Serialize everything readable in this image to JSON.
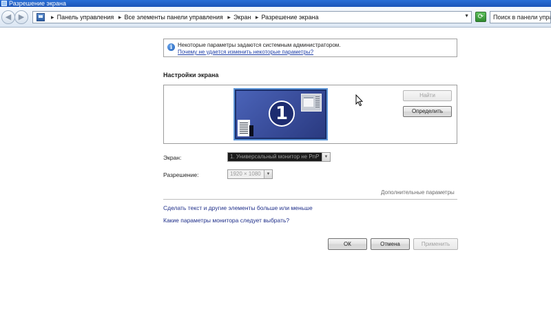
{
  "window": {
    "title": "Разрешение экрана"
  },
  "address_bar": {
    "crumbs": [
      "Панель управления",
      "Все элементы панели управления",
      "Экран",
      "Разрешение экрана"
    ],
    "search_placeholder": "Поиск в панели управ"
  },
  "nav": {
    "back_glyph": "◀",
    "forward_glyph": "▶",
    "refresh_glyph": "⟳"
  },
  "info": {
    "message": "Некоторые параметры задаются системным администратором.",
    "link": "Почему не удается изменить некоторые параметры?"
  },
  "settings": {
    "title": "Настройки экрана",
    "monitor_number": "1",
    "find_button": "Найти",
    "identify_button": "Определить",
    "screen_label": "Экран:",
    "screen_value": "1. Универсальный монитор не PnP",
    "resolution_label": "Разрешение:",
    "resolution_value": "1920 × 1080",
    "advanced_link": "Дополнительные параметры"
  },
  "links": {
    "text_size": "Сделать текст и другие элементы больше или меньше",
    "which_settings": "Какие параметры монитора следует выбрать?"
  },
  "buttons": {
    "ok": "ОК",
    "cancel": "Отмена",
    "apply": "Применить"
  },
  "icons": {
    "title_icon": "display-settings-icon",
    "address_icon": "control-panel-icon",
    "info_icon": "info-icon",
    "refresh_icon": "refresh-icon",
    "cursor": "mouse-pointer-icon"
  },
  "colors": {
    "titlebar": "#2a6fd6",
    "monitor_border": "#5e96d8",
    "link": "#1f2f8a"
  }
}
